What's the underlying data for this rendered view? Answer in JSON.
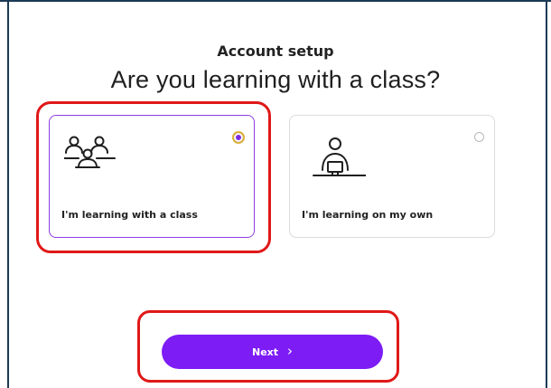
{
  "header": {
    "kicker": "Account setup",
    "question": "Are you learning with a class?"
  },
  "options": [
    {
      "label": "I'm learning with a class",
      "icon": "class-group-icon",
      "selected": true
    },
    {
      "label": "I'm learning on my own",
      "icon": "solo-learner-icon",
      "selected": false
    }
  ],
  "actions": {
    "next_label": "Next",
    "next_icon": "chevron-right-icon",
    "next_glyph": "›"
  },
  "colors": {
    "accent": "#7d1cf5",
    "selected_border": "#8c3fe0",
    "annotation": "#e01818",
    "frame": "#1b3a55"
  }
}
